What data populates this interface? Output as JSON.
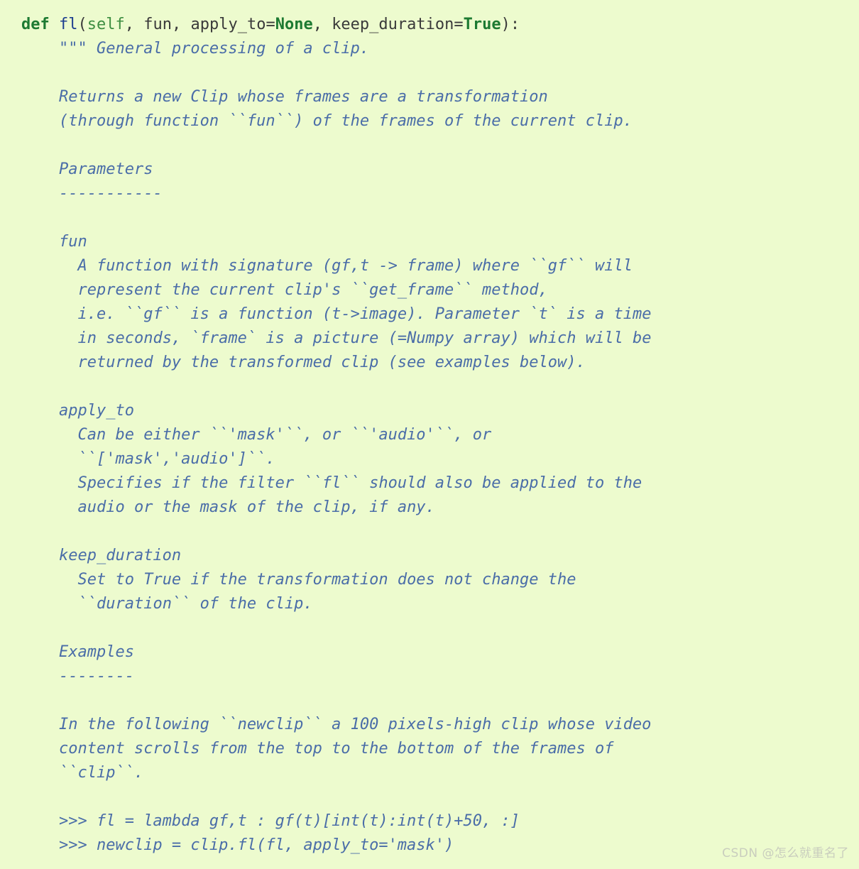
{
  "document": {
    "kind": "python-docstring-snippet",
    "background_color": "#edfbce",
    "colors": {
      "keyword": "#1d7a32",
      "function_name": "#1d3f8f",
      "self_param": "#3e8e41",
      "plain_code": "#3a3a3a",
      "docstring": "#4a6da8",
      "watermark": "#c9cdbe"
    }
  },
  "signature": {
    "keyword_def": "def",
    "function_name": "fl",
    "open_paren": "(",
    "param_self": "self",
    "sep1": ", ",
    "param_fun": "fun",
    "sep2": ", ",
    "param_apply_to": "apply_to=",
    "default_none": "None",
    "sep3": ", ",
    "param_keep_duration": "keep_duration=",
    "default_true": "True",
    "close_paren": "):"
  },
  "lines": [
    {
      "indent": "    ",
      "text": "\"\"\" General processing of a clip."
    },
    {
      "indent": "",
      "text": ""
    },
    {
      "indent": "    ",
      "text": "Returns a new Clip whose frames are a transformation"
    },
    {
      "indent": "    ",
      "text": "(through function ``fun``) of the frames of the current clip."
    },
    {
      "indent": "",
      "text": ""
    },
    {
      "indent": "    ",
      "text": "Parameters"
    },
    {
      "indent": "    ",
      "text": "-----------"
    },
    {
      "indent": "",
      "text": ""
    },
    {
      "indent": "    ",
      "text": "fun"
    },
    {
      "indent": "      ",
      "text": "A function with signature (gf,t -> frame) where ``gf`` will"
    },
    {
      "indent": "      ",
      "text": "represent the current clip's ``get_frame`` method,"
    },
    {
      "indent": "      ",
      "text": "i.e. ``gf`` is a function (t->image). Parameter `t` is a time"
    },
    {
      "indent": "      ",
      "text": "in seconds, `frame` is a picture (=Numpy array) which will be"
    },
    {
      "indent": "      ",
      "text": "returned by the transformed clip (see examples below)."
    },
    {
      "indent": "",
      "text": ""
    },
    {
      "indent": "    ",
      "text": "apply_to"
    },
    {
      "indent": "      ",
      "text": "Can be either ``'mask'``, or ``'audio'``, or"
    },
    {
      "indent": "      ",
      "text": "``['mask','audio']``."
    },
    {
      "indent": "      ",
      "text": "Specifies if the filter ``fl`` should also be applied to the"
    },
    {
      "indent": "      ",
      "text": "audio or the mask of the clip, if any."
    },
    {
      "indent": "",
      "text": ""
    },
    {
      "indent": "    ",
      "text": "keep_duration"
    },
    {
      "indent": "      ",
      "text": "Set to True if the transformation does not change the"
    },
    {
      "indent": "      ",
      "text": "``duration`` of the clip."
    },
    {
      "indent": "",
      "text": ""
    },
    {
      "indent": "    ",
      "text": "Examples"
    },
    {
      "indent": "    ",
      "text": "--------"
    },
    {
      "indent": "",
      "text": ""
    },
    {
      "indent": "    ",
      "text": "In the following ``newclip`` a 100 pixels-high clip whose video"
    },
    {
      "indent": "    ",
      "text": "content scrolls from the top to the bottom of the frames of"
    },
    {
      "indent": "    ",
      "text": "``clip``."
    },
    {
      "indent": "",
      "text": ""
    },
    {
      "indent": "    ",
      "text": ">>> fl = lambda gf,t : gf(t)[int(t):int(t)+50, :]"
    },
    {
      "indent": "    ",
      "text": ">>> newclip = clip.fl(fl, apply_to='mask')"
    }
  ],
  "watermark": {
    "text": "CSDN @怎么就重名了"
  }
}
